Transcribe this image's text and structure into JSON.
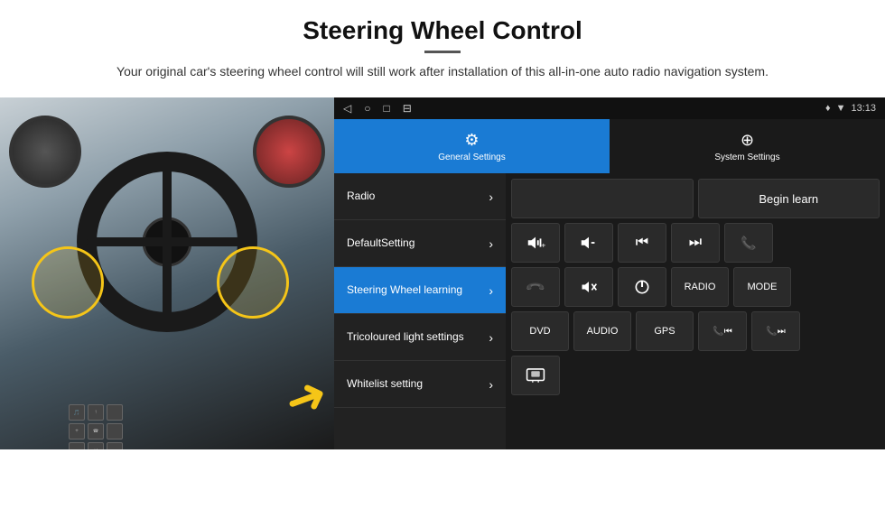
{
  "header": {
    "title": "Steering Wheel Control",
    "subtitle": "Your original car's steering wheel control will still work after installation of this all-in-one auto radio navigation system."
  },
  "status_bar": {
    "nav_icons": [
      "◁",
      "○",
      "□",
      "⊟"
    ],
    "right_icons": [
      "♦",
      "▼",
      "13:13"
    ]
  },
  "tabs": [
    {
      "id": "general",
      "label": "General Settings",
      "icon": "⚙",
      "active": true
    },
    {
      "id": "system",
      "label": "System Settings",
      "icon": "⊕",
      "active": false
    }
  ],
  "menu_items": [
    {
      "id": "radio",
      "label": "Radio",
      "active": false
    },
    {
      "id": "default",
      "label": "DefaultSetting",
      "active": false
    },
    {
      "id": "steering",
      "label": "Steering Wheel learning",
      "active": true
    },
    {
      "id": "tricoloured",
      "label": "Tricoloured light settings",
      "active": false
    },
    {
      "id": "whitelist",
      "label": "Whitelist setting",
      "active": false
    }
  ],
  "buttons": {
    "begin_learn": "Begin learn",
    "row2": [
      "🔊+",
      "🔊-",
      "⏮",
      "⏭",
      "📞"
    ],
    "row3": [
      "📞",
      "🔇",
      "⏻",
      "RADIO",
      "MODE"
    ],
    "row4": [
      "DVD",
      "AUDIO",
      "GPS",
      "📞⏮",
      "📞⏭"
    ],
    "row5": [
      "🚌"
    ]
  }
}
